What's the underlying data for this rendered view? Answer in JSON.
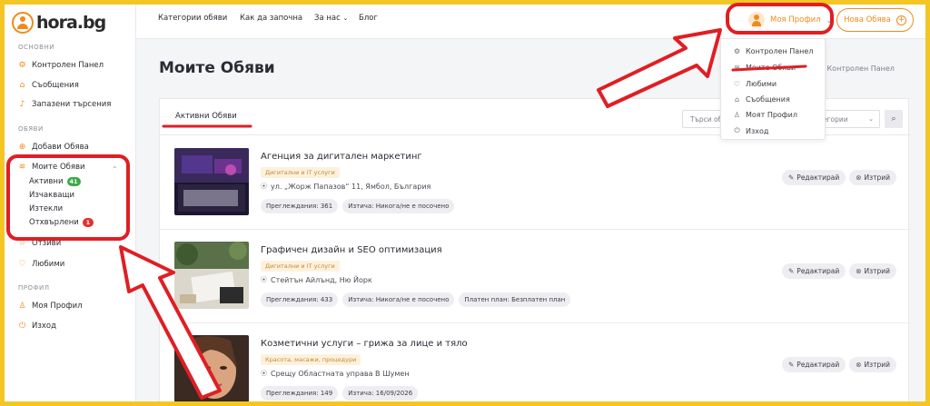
{
  "logo": {
    "text": "hora.bg"
  },
  "sidebar": {
    "sections": [
      {
        "label": "ОСНОВНИ"
      },
      {
        "label": "ОБЯВИ"
      },
      {
        "label": "ПРОФИЛ"
      }
    ],
    "items": [
      {
        "label": "Контролен Панел",
        "icon": "gear-icon"
      },
      {
        "label": "Съобщения",
        "icon": "home-icon"
      },
      {
        "label": "Запазени търсения",
        "icon": "bell-icon"
      },
      {
        "label": "Добави Обява",
        "icon": "plus-circle-icon"
      },
      {
        "label": "Моите Обяви",
        "icon": "layers-icon"
      },
      {
        "label": "Отзиви",
        "icon": "star-icon"
      },
      {
        "label": "Любими",
        "icon": "heart-icon"
      },
      {
        "label": "Моя Профил",
        "icon": "user-icon"
      },
      {
        "label": "Изход",
        "icon": "power-icon"
      }
    ],
    "sub_items": [
      {
        "label": "Активни",
        "badge": "41",
        "badge_color": "#3fa94a"
      },
      {
        "label": "Изчакващи"
      },
      {
        "label": "Изтекли"
      },
      {
        "label": "Отхвърлени",
        "badge": "1",
        "badge_color": "#e0312f"
      }
    ]
  },
  "header": {
    "nav": [
      "Категории обяви",
      "Как да започна",
      "За нас",
      "Блог"
    ],
    "profile_label": "Моя Профил",
    "new_ad_label": "Нова Обява"
  },
  "dropdown": {
    "items": [
      {
        "label": "Контролен Панел",
        "icon": "gear-icon"
      },
      {
        "label": "Моите Обяви",
        "icon": "layers-icon"
      },
      {
        "label": "Любими",
        "icon": "heart-icon"
      },
      {
        "label": "Съобщения",
        "icon": "home-icon"
      },
      {
        "label": "Моят Профил",
        "icon": "user-icon"
      },
      {
        "label": "Изход",
        "icon": "power-icon"
      }
    ]
  },
  "main": {
    "title": "Моите Обяви",
    "breadcrumb": "г  ›  Контролен Панел",
    "tab_active": "Активни Обяви",
    "search_placeholder": "Търси об",
    "category_placeholder": "егории",
    "listings": [
      {
        "title": "Агенция за дигитален маркетинг",
        "tag": "Дигитални и IT услуги",
        "location": "ул. „Жорж Папазов“ 11, Ямбол, България",
        "stats": [
          "Преглеждания: 361",
          "Изтича: Никога/не е посочено"
        ]
      },
      {
        "title": "Графичен дизайн и SEO оптимизация",
        "tag": "Дигитални и IT услуги",
        "location": "Стейтън Айлънд, Ню Йорк",
        "stats": [
          "Преглеждания: 433",
          "Изтича: Никога/не е посочено",
          "Платен план: Безплатен план"
        ]
      },
      {
        "title": "Козметични услуги – грижа за лице и тяло",
        "tag": "Красота, масажи, процедури",
        "location": "Срещу Областната управа В Шумен",
        "stats": [
          "Преглеждания: 149",
          "Изтича: 16/09/2026"
        ]
      }
    ],
    "edit_label": "Редактирай",
    "delete_label": "Изтрий"
  },
  "colors": {
    "accent": "#f08a1c",
    "frame": "#f3c623",
    "annotation": "#e01e24"
  }
}
